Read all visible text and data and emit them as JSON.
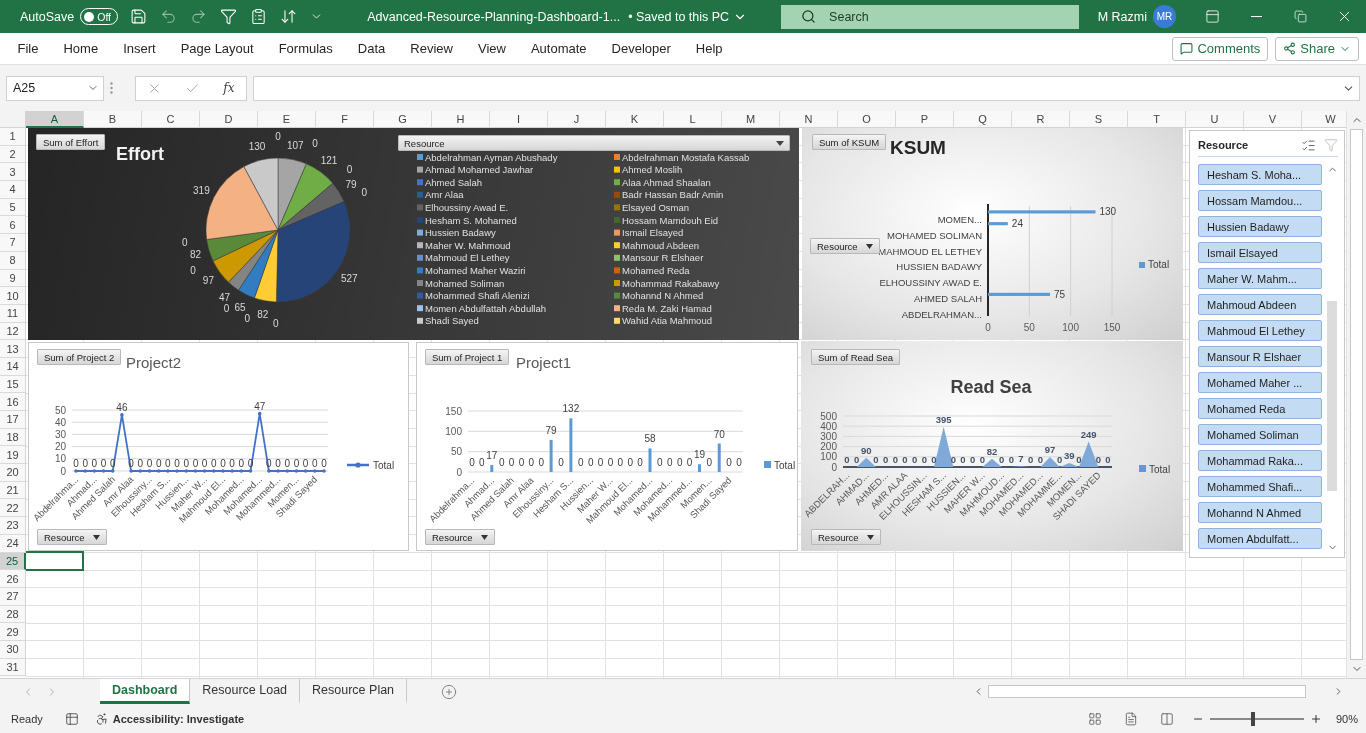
{
  "title_bar": {
    "autosave_label": "AutoSave",
    "autosave": {
      "label": "Off",
      "on": false
    },
    "file_name": "Advanced-Resource-Planning-Dashboard-1...",
    "save_status": "• Saved to this PC",
    "search": {
      "placeholder": "Search"
    },
    "user": {
      "name": "M Razmi",
      "initials": "MR"
    }
  },
  "menu": [
    "File",
    "Home",
    "Insert",
    "Page Layout",
    "Formulas",
    "Data",
    "Review",
    "View",
    "Automate",
    "Developer",
    "Help"
  ],
  "actions": {
    "comments": "Comments",
    "share": "Share"
  },
  "formula_bar": {
    "name_box": "A25",
    "fx": "fx"
  },
  "columns": [
    {
      "label": "A",
      "selected": true
    },
    {
      "label": "B",
      "selected": false
    },
    {
      "label": "C",
      "selected": false
    },
    {
      "label": "D",
      "selected": false
    },
    {
      "label": "E",
      "selected": false
    },
    {
      "label": "F",
      "selected": false
    },
    {
      "label": "G",
      "selected": false
    },
    {
      "label": "H",
      "selected": false
    },
    {
      "label": "I",
      "selected": false
    },
    {
      "label": "J",
      "selected": false
    },
    {
      "label": "K",
      "selected": false
    },
    {
      "label": "L",
      "selected": false
    },
    {
      "label": "M",
      "selected": false
    },
    {
      "label": "N",
      "selected": false
    },
    {
      "label": "O",
      "selected": false
    },
    {
      "label": "P",
      "selected": false
    },
    {
      "label": "Q",
      "selected": false
    },
    {
      "label": "R",
      "selected": false
    },
    {
      "label": "S",
      "selected": false
    },
    {
      "label": "T",
      "selected": false
    },
    {
      "label": "U",
      "selected": false
    },
    {
      "label": "V",
      "selected": false
    },
    {
      "label": "W",
      "selected": false
    }
  ],
  "rows": [
    {
      "label": "1",
      "selected": false
    },
    {
      "label": "2",
      "selected": false
    },
    {
      "label": "3",
      "selected": false
    },
    {
      "label": "4",
      "selected": false
    },
    {
      "label": "5",
      "selected": false
    },
    {
      "label": "6",
      "selected": false
    },
    {
      "label": "7",
      "selected": false
    },
    {
      "label": "8",
      "selected": false
    },
    {
      "label": "9",
      "selected": false
    },
    {
      "label": "10",
      "selected": false
    },
    {
      "label": "11",
      "selected": false
    },
    {
      "label": "12",
      "selected": false
    },
    {
      "label": "13",
      "selected": false
    },
    {
      "label": "14",
      "selected": false
    },
    {
      "label": "15",
      "selected": false
    },
    {
      "label": "16",
      "selected": false
    },
    {
      "label": "17",
      "selected": false
    },
    {
      "label": "18",
      "selected": false
    },
    {
      "label": "19",
      "selected": false
    },
    {
      "label": "20",
      "selected": false
    },
    {
      "label": "21",
      "selected": false
    },
    {
      "label": "22",
      "selected": false
    },
    {
      "label": "23",
      "selected": false
    },
    {
      "label": "24",
      "selected": false
    },
    {
      "label": "25",
      "selected": true
    },
    {
      "label": "26",
      "selected": false
    },
    {
      "label": "27",
      "selected": false
    },
    {
      "label": "28",
      "selected": false
    },
    {
      "label": "29",
      "selected": false
    },
    {
      "label": "30",
      "selected": false
    },
    {
      "label": "31",
      "selected": false
    }
  ],
  "effort_chart": {
    "field_button": "Sum of Effort",
    "legend_button": "Resource",
    "legend": [
      {
        "label": "Abdelrahman Ayman Abushady",
        "color": "#5b9bd5"
      },
      {
        "label": "Abdelrahman Mostafa Kassab",
        "color": "#ed7d31"
      },
      {
        "label": "Ahmad Mohamed Jawhar",
        "color": "#a5a5a5"
      },
      {
        "label": "Ahmed Moslih",
        "color": "#ffc000"
      },
      {
        "label": "Ahmed Salah",
        "color": "#4472c4"
      },
      {
        "label": "Alaa Ahmad Shaalan",
        "color": "#70ad47"
      },
      {
        "label": "Amr Alaa",
        "color": "#255e91"
      },
      {
        "label": "Badr Hassan Badr Amin",
        "color": "#9e480e"
      },
      {
        "label": "Elhoussiny Awad E.",
        "color": "#636363"
      },
      {
        "label": "Elsayed Osman",
        "color": "#997300"
      },
      {
        "label": "Hesham S. Mohamed",
        "color": "#264478"
      },
      {
        "label": "Hossam Mamdouh Eid",
        "color": "#43682b"
      },
      {
        "label": "Hussien Badawy",
        "color": "#7cafdd"
      },
      {
        "label": "Ismail Elsayed",
        "color": "#f1975a"
      },
      {
        "label": "Maher W. Mahmoud",
        "color": "#b7b7b7"
      },
      {
        "label": "Mahmoud Abdeen",
        "color": "#ffcd33"
      },
      {
        "label": "Mahmoud El Lethey",
        "color": "#698ed0"
      },
      {
        "label": "Mansour R Elshaer",
        "color": "#8cc168"
      },
      {
        "label": "Mohamed Maher Waziri",
        "color": "#327dc2"
      },
      {
        "label": "Mohamed Reda",
        "color": "#d26012"
      },
      {
        "label": "Mohamed Soliman",
        "color": "#848484"
      },
      {
        "label": "Mohammad Rakabawy",
        "color": "#cc9a00"
      },
      {
        "label": "Mohammed Shafi Alenizi",
        "color": "#335aa1"
      },
      {
        "label": "Mohannd N Ahmed",
        "color": "#5a8a39"
      },
      {
        "label": "Momen Abdulfattah Abdullah",
        "color": "#9dc3e6"
      },
      {
        "label": "Reda M. Zaki Hamad",
        "color": "#f4b183"
      },
      {
        "label": "Shadi Sayed",
        "color": "#c9c9c9"
      },
      {
        "label": "Wahid Atia Mahmoud",
        "color": "#ffd966"
      }
    ],
    "chart_data": {
      "type": "pie",
      "title": "Effort",
      "value_labels": [
        null,
        null,
        "107",
        "0",
        null,
        "121",
        "0",
        null,
        "79",
        "0",
        "527",
        "0",
        null,
        null,
        null,
        "82",
        "0",
        null,
        "65",
        "0",
        "47",
        "97",
        "0",
        "82",
        "0",
        "319",
        "130",
        "0"
      ],
      "values": [
        0,
        0,
        107,
        0,
        0,
        121,
        0,
        0,
        79,
        0,
        527,
        0,
        0,
        0,
        0,
        82,
        0,
        0,
        65,
        0,
        47,
        97,
        0,
        82,
        0,
        319,
        130,
        0
      ]
    }
  },
  "ksum_chart": {
    "field_button": "Sum of KSUM",
    "axis_button": "Resource",
    "legend_label": "Total",
    "axis_labels": [
      "MOMEN...",
      "MOHAMED SOLIMAN",
      "MAHMOUD EL LETHEY",
      "HUSSIEN BADAWY",
      "ELHOUSSINY AWAD E.",
      "AHMED SALAH",
      "ABDELRAHMAN..."
    ],
    "chart_data": {
      "type": "bar",
      "orientation": "horizontal",
      "title": "KSUM",
      "xlim": [
        0,
        150
      ],
      "xticks": [
        0,
        50,
        100,
        150
      ],
      "grid": true,
      "value_labels": [
        null,
        "130",
        null,
        null,
        "24",
        null,
        null,
        null,
        null,
        null,
        null,
        null,
        null,
        null,
        null,
        null,
        null,
        null,
        null,
        null,
        null,
        null,
        "75",
        null,
        null,
        null,
        null,
        null
      ],
      "values": [
        0,
        130,
        0,
        0,
        24,
        0,
        0,
        0,
        0,
        0,
        0,
        0,
        0,
        0,
        0,
        0,
        0,
        0,
        0,
        0,
        0,
        0,
        75,
        0,
        0,
        0,
        0,
        0
      ]
    }
  },
  "slicer": {
    "title": "Resource",
    "items": [
      {
        "label": "Hesham S. Moha...",
        "selected": true
      },
      {
        "label": "Hossam Mamdou...",
        "selected": true
      },
      {
        "label": "Hussien Badawy",
        "selected": true
      },
      {
        "label": "Ismail Elsayed",
        "selected": true
      },
      {
        "label": "Maher W. Mahm...",
        "selected": true
      },
      {
        "label": "Mahmoud Abdeen",
        "selected": true
      },
      {
        "label": "Mahmoud El Lethey",
        "selected": true
      },
      {
        "label": "Mansour R Elshaer",
        "selected": true
      },
      {
        "label": "Mohamed Maher ...",
        "selected": true
      },
      {
        "label": "Mohamed Reda",
        "selected": true
      },
      {
        "label": "Mohamed Soliman",
        "selected": true
      },
      {
        "label": "Mohammad Raka...",
        "selected": true
      },
      {
        "label": "Mohammed Shafi...",
        "selected": true
      },
      {
        "label": "Mohannd N Ahmed",
        "selected": true
      },
      {
        "label": "Momen Abdulfatt...",
        "selected": true
      }
    ]
  },
  "project2_chart": {
    "field_button": "Sum of Project 2",
    "axis_button": "Resource",
    "legend_label": "Total",
    "axis_labels": [
      "Abdelrahma...",
      "Ahmad...",
      "Ahmed Salah",
      "Amr Alaa",
      "Elhoussiny...",
      "Hesham S...",
      "Hussien...",
      "Maher W...",
      "Mahmoud El...",
      "Mohamed...",
      "Mohamed...",
      "Mohammed...",
      "Momen...",
      "Shadi Sayed"
    ],
    "chart_data": {
      "type": "line",
      "title": "Project2",
      "ylim": [
        0,
        50
      ],
      "yticks": [
        0,
        10,
        20,
        30,
        40,
        50
      ],
      "grid": true,
      "data_labels": true,
      "values": [
        0,
        0,
        0,
        0,
        0,
        46,
        0,
        0,
        0,
        0,
        0,
        0,
        0,
        0,
        0,
        0,
        0,
        0,
        0,
        0,
        47,
        0,
        0,
        0,
        0,
        0,
        0,
        0
      ]
    }
  },
  "project1_chart": {
    "field_button": "Sum of Project 1",
    "axis_button": "Resource",
    "legend_label": "Total",
    "axis_labels": [
      "Abdelrahma...",
      "Ahmad...",
      "Ahmed Salah",
      "Amr Alaa",
      "Elhoussiny...",
      "Hesham S...",
      "Hussien...",
      "Maher W...",
      "Mahmoud El...",
      "Mohamed...",
      "Mohamed...",
      "Mohammed...",
      "Momen...",
      "Shadi Sayed"
    ],
    "chart_data": {
      "type": "bar",
      "title": "Project1",
      "ylim": [
        0,
        150
      ],
      "yticks": [
        0,
        50,
        100,
        150
      ],
      "grid": true,
      "data_labels": true,
      "values": [
        0,
        0,
        17,
        0,
        0,
        0,
        0,
        0,
        79,
        0,
        132,
        0,
        0,
        0,
        0,
        0,
        0,
        0,
        58,
        0,
        0,
        0,
        0,
        19,
        0,
        70,
        0,
        0
      ]
    }
  },
  "read_sea_chart": {
    "field_button": "Sum of Read Sea",
    "axis_button": "Resource",
    "legend_label": "Total",
    "axis_labels": [
      "ABDELRAH...",
      "AHMAD...",
      "AHMED...",
      "AMR ALAA",
      "ELHOUSSIN...",
      "HESHAM S...",
      "HUSSIEN...",
      "MAHER W...",
      "MAHMOUD...",
      "MOHAMED...",
      "MOHAMED...",
      "MOHAMME...",
      "MOMEN...",
      "SHADI SAYED"
    ],
    "chart_data": {
      "type": "area",
      "title": "Read Sea",
      "ylim": [
        0,
        500
      ],
      "yticks": [
        0,
        100,
        200,
        300,
        400,
        500
      ],
      "grid": true,
      "data_labels": true,
      "values": [
        0,
        0,
        90,
        0,
        0,
        0,
        0,
        0,
        0,
        0,
        395,
        0,
        0,
        0,
        0,
        82,
        0,
        0,
        7,
        0,
        0,
        97,
        0,
        39,
        0,
        249,
        0,
        0
      ]
    }
  },
  "sheet_tabs": [
    {
      "label": "Dashboard",
      "selected": true
    },
    {
      "label": "Resource Load",
      "selected": false
    },
    {
      "label": "Resource Plan",
      "selected": false
    }
  ],
  "status_bar": {
    "ready": "Ready",
    "accessibility": "Accessibility: Investigate",
    "zoom": "90%",
    "zoom_slider": {
      "level": 0.46
    }
  }
}
